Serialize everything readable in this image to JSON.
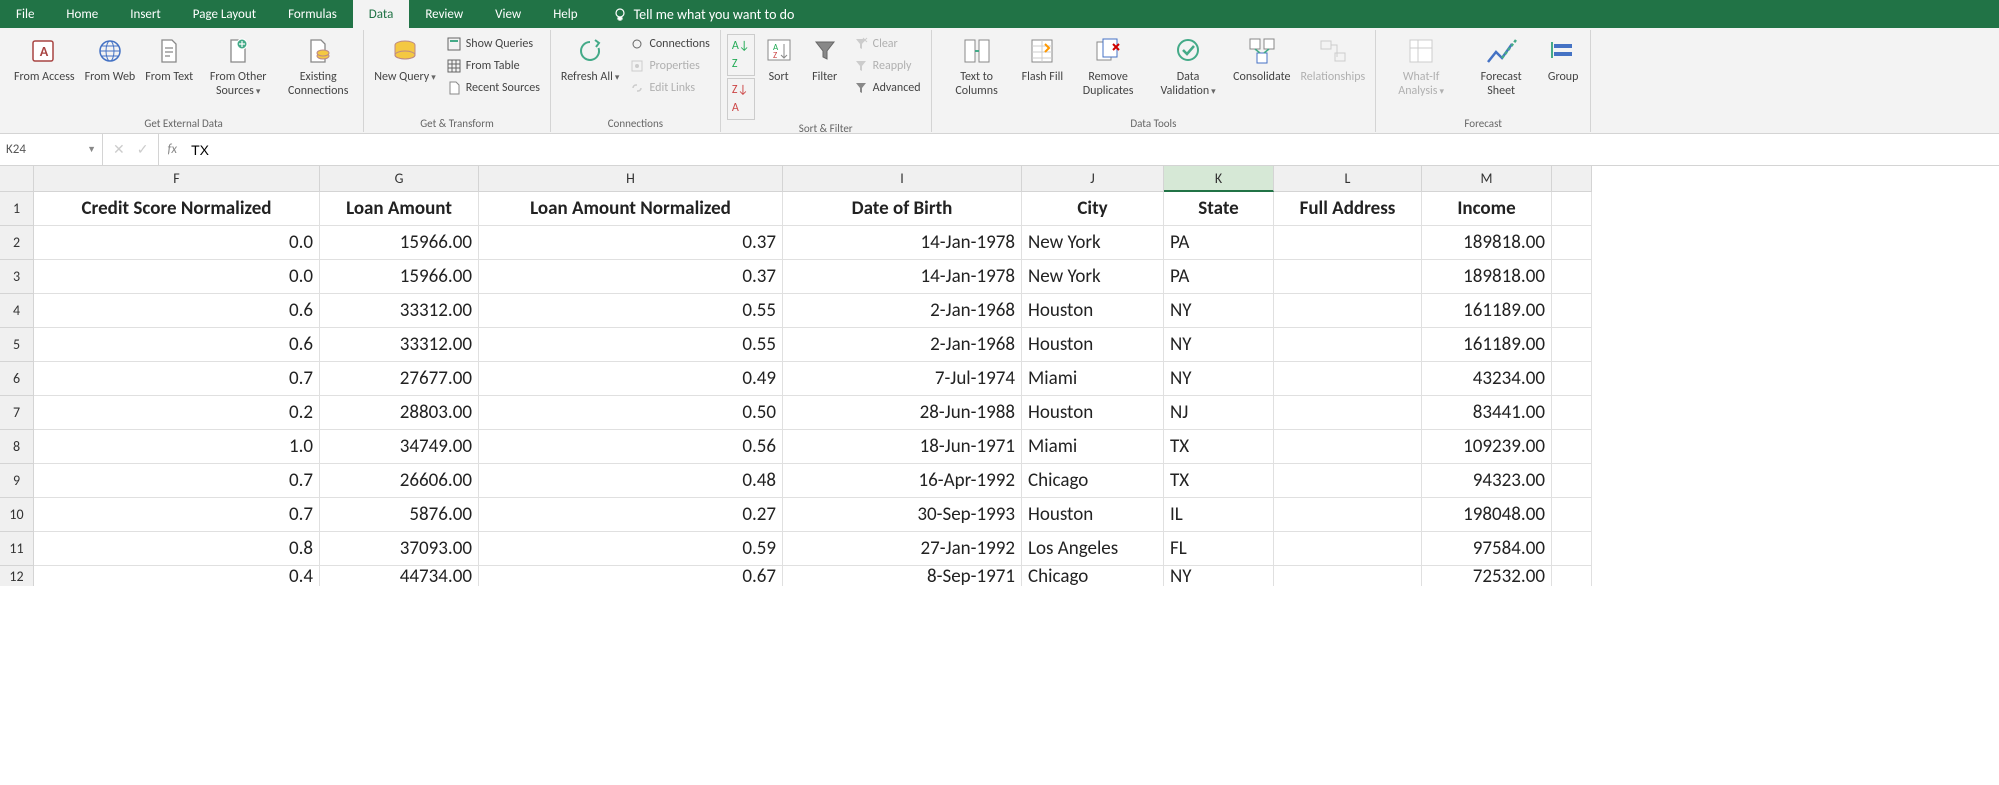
{
  "menu": {
    "tabs": [
      "File",
      "Home",
      "Insert",
      "Page Layout",
      "Formulas",
      "Data",
      "Review",
      "View",
      "Help"
    ],
    "active": "Data",
    "tell_me": "Tell me what you want to do"
  },
  "ribbon": {
    "groups": {
      "get_external": {
        "label": "Get External Data",
        "from_access": "From Access",
        "from_web": "From Web",
        "from_text": "From Text",
        "from_other": "From Other Sources",
        "existing": "Existing Connections"
      },
      "get_transform": {
        "label": "Get & Transform",
        "new_query": "New Query",
        "show_queries": "Show Queries",
        "from_table": "From Table",
        "recent_sources": "Recent Sources"
      },
      "connections": {
        "label": "Connections",
        "refresh_all": "Refresh All",
        "conns": "Connections",
        "properties": "Properties",
        "edit_links": "Edit Links"
      },
      "sort_filter": {
        "label": "Sort & Filter",
        "sort": "Sort",
        "filter": "Filter",
        "clear": "Clear",
        "reapply": "Reapply",
        "advanced": "Advanced"
      },
      "data_tools": {
        "label": "Data Tools",
        "text_cols": "Text to Columns",
        "flash_fill": "Flash Fill",
        "remove_dups": "Remove Duplicates",
        "validation": "Data Validation",
        "consolidate": "Consolidate",
        "relationships": "Relationships"
      },
      "forecast": {
        "label": "Forecast",
        "whatif": "What-If Analysis",
        "forecast_sheet": "Forecast Sheet",
        "group": "Group"
      }
    }
  },
  "formula_bar": {
    "cell_ref": "K24",
    "value": "TX"
  },
  "columns": [
    "F",
    "G",
    "H",
    "I",
    "J",
    "K",
    "L",
    "M"
  ],
  "selected_col": "K",
  "headers": [
    "Credit Score Normalized",
    "Loan Amount",
    "Loan Amount Normalized",
    "Date of Birth",
    "City",
    "State",
    "Full Address",
    "Income"
  ],
  "rows": [
    {
      "n": 1,
      "cells": null
    },
    {
      "n": 2,
      "cells": [
        "0.0",
        "15966.00",
        "0.37",
        "14-Jan-1978",
        "New York",
        "PA",
        "",
        "189818.00"
      ]
    },
    {
      "n": 3,
      "cells": [
        "0.0",
        "15966.00",
        "0.37",
        "14-Jan-1978",
        "New York",
        "PA",
        "",
        "189818.00"
      ]
    },
    {
      "n": 4,
      "cells": [
        "0.6",
        "33312.00",
        "0.55",
        "2-Jan-1968",
        "Houston",
        "NY",
        "",
        "161189.00"
      ]
    },
    {
      "n": 5,
      "cells": [
        "0.6",
        "33312.00",
        "0.55",
        "2-Jan-1968",
        "Houston",
        "NY",
        "",
        "161189.00"
      ]
    },
    {
      "n": 6,
      "cells": [
        "0.7",
        "27677.00",
        "0.49",
        "7-Jul-1974",
        "Miami",
        "NY",
        "",
        "43234.00"
      ]
    },
    {
      "n": 7,
      "cells": [
        "0.2",
        "28803.00",
        "0.50",
        "28-Jun-1988",
        "Houston",
        "NJ",
        "",
        "83441.00"
      ]
    },
    {
      "n": 8,
      "cells": [
        "1.0",
        "34749.00",
        "0.56",
        "18-Jun-1971",
        "Miami",
        "TX",
        "",
        "109239.00"
      ]
    },
    {
      "n": 9,
      "cells": [
        "0.7",
        "26606.00",
        "0.48",
        "16-Apr-1992",
        "Chicago",
        "TX",
        "",
        "94323.00"
      ]
    },
    {
      "n": 10,
      "cells": [
        "0.7",
        "5876.00",
        "0.27",
        "30-Sep-1993",
        "Houston",
        "IL",
        "",
        "198048.00"
      ]
    },
    {
      "n": 11,
      "cells": [
        "0.8",
        "37093.00",
        "0.59",
        "27-Jan-1992",
        "Los Angeles",
        "FL",
        "",
        "97584.00"
      ]
    },
    {
      "n": 12,
      "cells": [
        "0.4",
        "44734.00",
        "0.67",
        "8-Sep-1971",
        "Chicago",
        "NY",
        "",
        "72532.00"
      ]
    }
  ],
  "col_align": [
    "num",
    "num",
    "num",
    "num",
    "txt",
    "txt",
    "txt",
    "num"
  ]
}
